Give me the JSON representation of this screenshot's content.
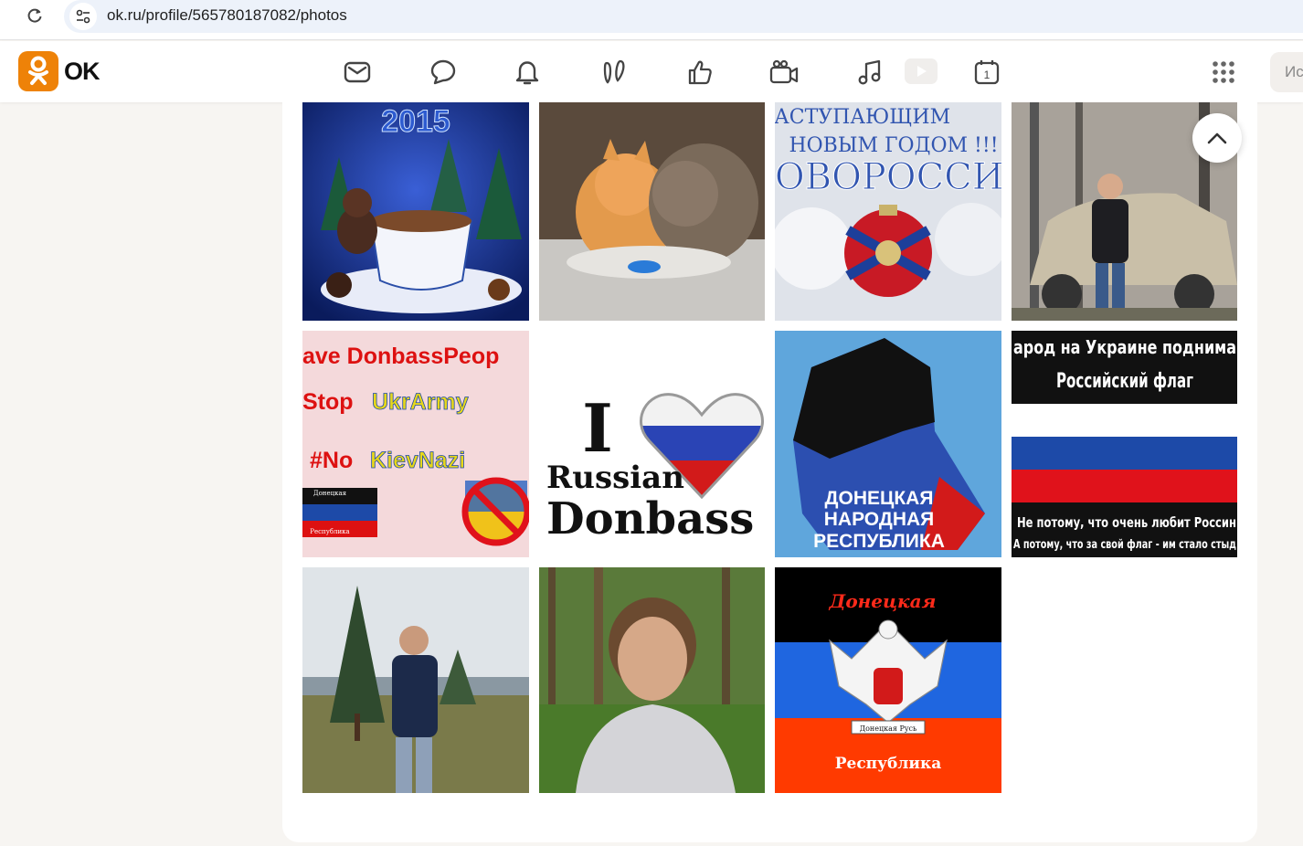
{
  "browser": {
    "url": "ok.ru/profile/565780187082/photos"
  },
  "header": {
    "logo_text": "OK",
    "search_placeholder": "Ис",
    "nav_icons": [
      "mail-icon",
      "chat-icon",
      "bell-icon",
      "guests-icon",
      "likes-icon",
      "camera-icon",
      "music-icon",
      "video-icon",
      "calendar-icon"
    ],
    "calendar_day": "1",
    "brand_color": "#ee8208"
  },
  "photos": [
    {
      "name": "photo-new-year-2015",
      "texts": [
        "2015"
      ]
    },
    {
      "name": "photo-kittens",
      "texts": []
    },
    {
      "name": "photo-novorossiya-new-year",
      "texts": [
        "НАСТУПАЮЩИМ",
        "НОВЫМ ГОДОМ !!!",
        "НОВОРОССИЯ"
      ]
    },
    {
      "name": "photo-man-with-car",
      "texts": []
    },
    {
      "name": "photo-save-donbass",
      "texts": [
        "ave DonbassPeop",
        "Stop",
        "UkrArmy",
        "#No",
        "KievNazi",
        "Донецкая",
        "Республика"
      ]
    },
    {
      "name": "photo-i-love-russian-donbass",
      "texts": [
        "I",
        "Russian",
        "Donbass"
      ]
    },
    {
      "name": "photo-dnr-map",
      "texts": [
        "ДОНЕЦКАЯ",
        "НАРОДНАЯ",
        "РЕСПУБЛИКА"
      ]
    },
    {
      "name": "photo-flag-poster",
      "texts": [
        "арод на Украине поднима",
        "Российский флаг",
        "Не потому, что очень любит Россин",
        "А потому, что за свой флаг - им стало стыд"
      ]
    },
    {
      "name": "photo-man-in-park",
      "texts": []
    },
    {
      "name": "photo-man-portrait",
      "texts": []
    },
    {
      "name": "photo-dnr-flag",
      "texts": [
        "Донецкая",
        "Донецкая Русь",
        "Республика"
      ]
    }
  ]
}
